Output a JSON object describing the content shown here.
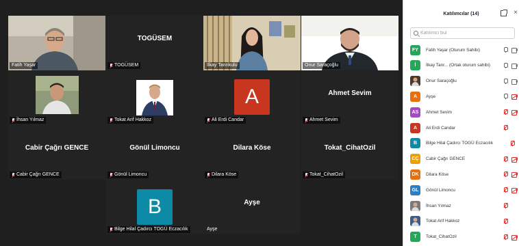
{
  "panel": {
    "title": "Katılımcılar (14)",
    "search_placeholder": "Katılımcı bul"
  },
  "participants": [
    {
      "initials": "FY",
      "color": "#23a85a",
      "name": "Fatih Yaşar (Oturum Sahibi)",
      "mic": "on",
      "cam": "on",
      "avatar": "initials"
    },
    {
      "initials": "İ",
      "color": "#23a85a",
      "name": "İlkay Tanr... (Ortak oturum sahibi)",
      "mic": "on",
      "cam": "on",
      "avatar": "initials"
    },
    {
      "initials": "",
      "color": "#4b3a2a",
      "name": "Onur Saraçoğlu",
      "mic": "on",
      "cam": "on",
      "avatar": "photo"
    },
    {
      "initials": "A",
      "color": "#e8700a",
      "name": "Ayşe",
      "mic": "on",
      "cam": "off",
      "avatar": "initials"
    },
    {
      "initials": "AS",
      "color": "#a44bc2",
      "name": "Ahmet Sevim",
      "mic": "off",
      "cam": "off",
      "avatar": "initials"
    },
    {
      "initials": "A",
      "color": "#c8361f",
      "name": "Ali Erdi Candar",
      "mic": "off",
      "cam": "none",
      "avatar": "initials"
    },
    {
      "initials": "B",
      "color": "#0d8aa6",
      "name": "Bilge Hilal Çadırcı TOGÜ Eczacılık",
      "mic": "none",
      "cam": "none",
      "avatar": "initials"
    },
    {
      "initials": "CÇ",
      "color": "#e8a10a",
      "name": "Cabir Çağrı GENCE",
      "mic": "off",
      "cam": "off",
      "avatar": "initials"
    },
    {
      "initials": "DK",
      "color": "#e8700a",
      "name": "Dilara Köse",
      "mic": "off",
      "cam": "off",
      "avatar": "initials"
    },
    {
      "initials": "GL",
      "color": "#2d7fc4",
      "name": "Gönül Limoncu",
      "mic": "off",
      "cam": "off",
      "avatar": "initials"
    },
    {
      "initials": "",
      "color": "#7a7a7a",
      "name": "İhsan Yılmaz",
      "mic": "off",
      "cam": "none",
      "avatar": "photo"
    },
    {
      "initials": "",
      "color": "#3d5b8a",
      "name": "Tokat Arif Hakkoz",
      "mic": "off",
      "cam": "none",
      "avatar": "photo"
    },
    {
      "initials": "T",
      "color": "#23a85a",
      "name": "Tokat_CihatOzil",
      "mic": "off",
      "cam": "off",
      "avatar": "initials"
    }
  ],
  "tiles": [
    {
      "name": "Fatih Yaşar",
      "kind": "video",
      "muted": false
    },
    {
      "name": "TOGÜSEM",
      "kind": "text",
      "muted": true
    },
    {
      "name": "İlkay Tanrıkulu",
      "kind": "video",
      "muted": false
    },
    {
      "name": "Onur Saraçoğlu",
      "kind": "video",
      "muted": false,
      "speaking": true
    },
    {
      "name": "İhsan Yılmaz",
      "kind": "photo",
      "muted": true
    },
    {
      "name": "Tokat Arif Hakkoz",
      "kind": "photo",
      "muted": true
    },
    {
      "name": "Ali Erdi Candar",
      "kind": "letter",
      "letter": "A",
      "color": "#c8361f",
      "muted": true
    },
    {
      "name": "Ahmet Sevim",
      "kind": "text",
      "muted": true
    },
    {
      "name": "Cabir Çağrı GENCE",
      "kind": "text",
      "muted": true
    },
    {
      "name": "Gönül Limoncu",
      "kind": "text",
      "muted": true
    },
    {
      "name": "Dilara Köse",
      "kind": "text",
      "muted": true
    },
    {
      "name": "Tokat_CihatOzil",
      "kind": "text",
      "muted": true
    },
    {
      "name": "Bilge Hilal Çadırcı TOGÜ Eczacılık",
      "kind": "letter",
      "letter": "B",
      "color": "#0d8aa6",
      "muted": true
    },
    {
      "name": "Ayşe",
      "kind": "text",
      "muted": false
    }
  ]
}
